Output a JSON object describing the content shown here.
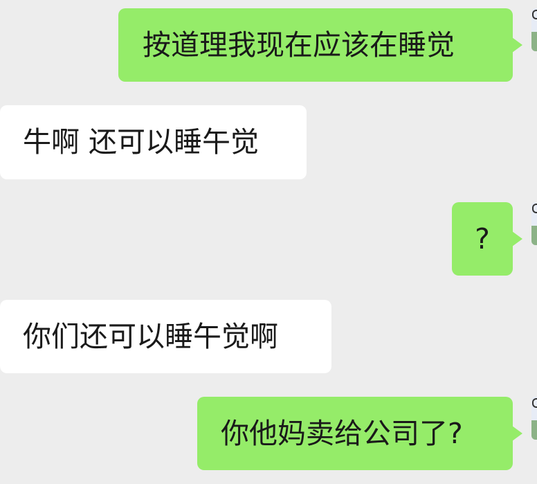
{
  "messages": [
    {
      "side": "sent",
      "text": "按道理我现在应该在睡觉"
    },
    {
      "side": "received",
      "text": "牛啊 还可以睡午觉"
    },
    {
      "side": "sent",
      "text": "?"
    },
    {
      "side": "received",
      "text": "你们还可以睡午觉啊"
    },
    {
      "side": "sent",
      "text": "你他妈卖给公司了?"
    }
  ],
  "colors": {
    "background": "#ededed",
    "sent_bubble": "#95ec69",
    "received_bubble": "#ffffff",
    "text": "#1a1a1a"
  }
}
